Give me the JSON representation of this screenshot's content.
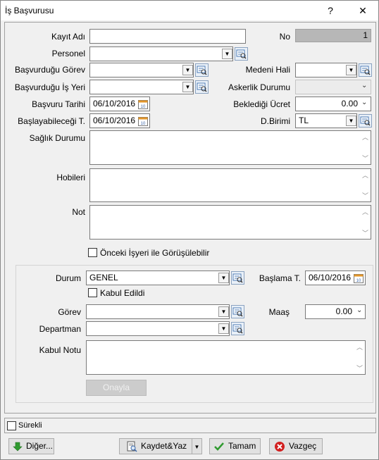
{
  "window": {
    "title": "İş Başvurusu",
    "help_label": "?",
    "close_label": "✕"
  },
  "form": {
    "kayit_adi": {
      "label": "Kayıt Adı",
      "value": ""
    },
    "no": {
      "label": "No",
      "value": "1"
    },
    "personel": {
      "label": "Personel",
      "value": ""
    },
    "basvurdugu_gorev": {
      "label": "Başvurduğu Görev",
      "value": ""
    },
    "medeni_hali": {
      "label": "Medeni Hali",
      "value": ""
    },
    "basvurdugu_is_yeri": {
      "label": "Başvurduğu İş Yeri",
      "value": ""
    },
    "askerlik_durumu": {
      "label": "Askerlik Durumu",
      "value": ""
    },
    "basvuru_tarihi": {
      "label": "Başvuru Tarihi",
      "value": "06/10/2016"
    },
    "bekledigi_ucret": {
      "label": "Beklediği Ücret",
      "value": "0.00"
    },
    "baslayabilecegi": {
      "label": "Başlayabileceği T.",
      "value": "06/10/2016"
    },
    "d_birimi": {
      "label": "D.Birimi",
      "value": "TL"
    },
    "saglik_durumu": {
      "label": "Sağlık Durumu"
    },
    "hobileri": {
      "label": "Hobileri"
    },
    "not": {
      "label": "Not"
    },
    "onceki_isyeri": {
      "label": "Önceki İşyeri ile Görüşülebilir",
      "checked": false
    }
  },
  "group": {
    "durum": {
      "label": "Durum",
      "value": "GENEL"
    },
    "baslama": {
      "label": "Başlama T.",
      "value": "06/10/2016"
    },
    "kabul_edildi": {
      "label": "Kabul Edildi",
      "checked": false
    },
    "gorev": {
      "label": "Görev",
      "value": ""
    },
    "maas": {
      "label": "Maaş",
      "value": "0.00"
    },
    "departman": {
      "label": "Departman",
      "value": ""
    },
    "kabul_notu": {
      "label": "Kabul Notu"
    },
    "onayla_label": "Onayla"
  },
  "footer": {
    "surekli_label": "Sürekli",
    "diger_label": "Diğer...",
    "kaydet_label": "Kaydet&Yaz",
    "tamam_label": "Tamam",
    "vazgec_label": "Vazgeç"
  },
  "colors": {
    "accent_blue": "#3a78c4",
    "ok_green": "#2f9a2f",
    "cancel_red": "#d21f1f"
  }
}
